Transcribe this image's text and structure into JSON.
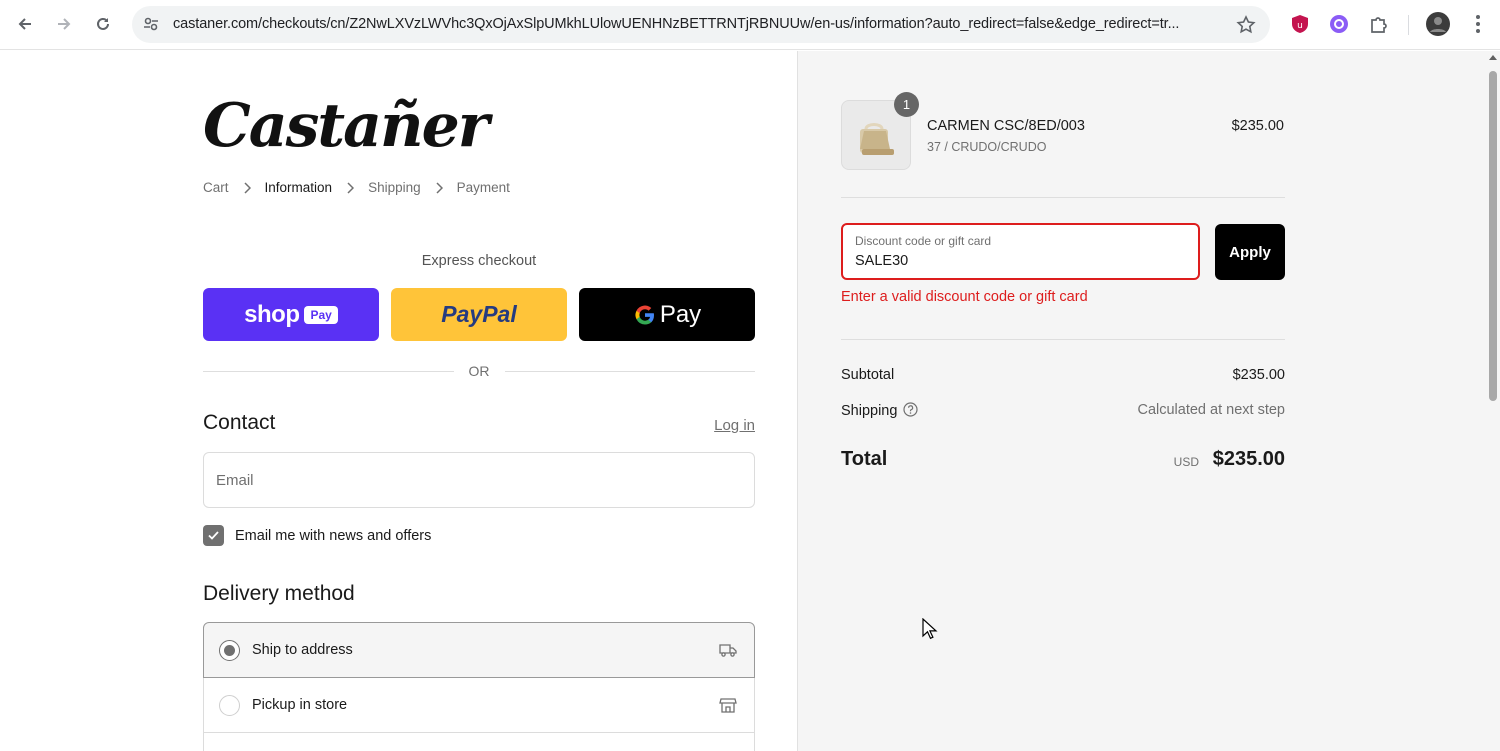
{
  "browser": {
    "url": "castaner.com/checkouts/cn/Z2NwLXVzLWVhc3QxOjAxSlpUMkhLUlowUENHNzBETTRNTjRBNUUw/en-us/information?auto_redirect=false&edge_redirect=tr...",
    "icons": [
      "back-icon",
      "forward-icon",
      "reload-icon",
      "site-info-icon",
      "star-icon",
      "ublock-icon",
      "extension-icon",
      "puzzle-icon",
      "profile-avatar",
      "menu-icon"
    ]
  },
  "store": {
    "logo_text": "Castañer"
  },
  "breadcrumb": {
    "cart": "Cart",
    "information": "Information",
    "shipping": "Shipping",
    "payment": "Payment"
  },
  "express": {
    "title": "Express checkout",
    "shoppay_label": "shop",
    "shoppay_pay": "Pay",
    "paypal_label": "PayPal",
    "gpay_label": "Pay",
    "or": "OR"
  },
  "contact": {
    "title": "Contact",
    "login": "Log in",
    "email_placeholder": "Email",
    "newsletter": "Email me with news and offers",
    "newsletter_checked": true
  },
  "delivery": {
    "title": "Delivery method",
    "options": [
      {
        "label": "Ship to address",
        "selected": true,
        "icon": "truck-icon"
      },
      {
        "label": "Pickup in store",
        "selected": false,
        "icon": "store-icon"
      }
    ]
  },
  "cart": {
    "item": {
      "quantity": "1",
      "name": "CARMEN CSC/8ED/003",
      "variant": "37 / CRUDO/CRUDO",
      "price": "$235.00"
    },
    "discount": {
      "label": "Discount code or gift card",
      "value": "SALE30",
      "apply": "Apply",
      "error": "Enter a valid discount code or gift card"
    },
    "subtotal_label": "Subtotal",
    "subtotal_value": "$235.00",
    "shipping_label": "Shipping",
    "shipping_value": "Calculated at next step",
    "total_label": "Total",
    "currency": "USD",
    "total_value": "$235.00"
  },
  "colors": {
    "error": "#dd1d1d",
    "shoppay": "#5a31f4",
    "paypal": "#ffc439"
  }
}
